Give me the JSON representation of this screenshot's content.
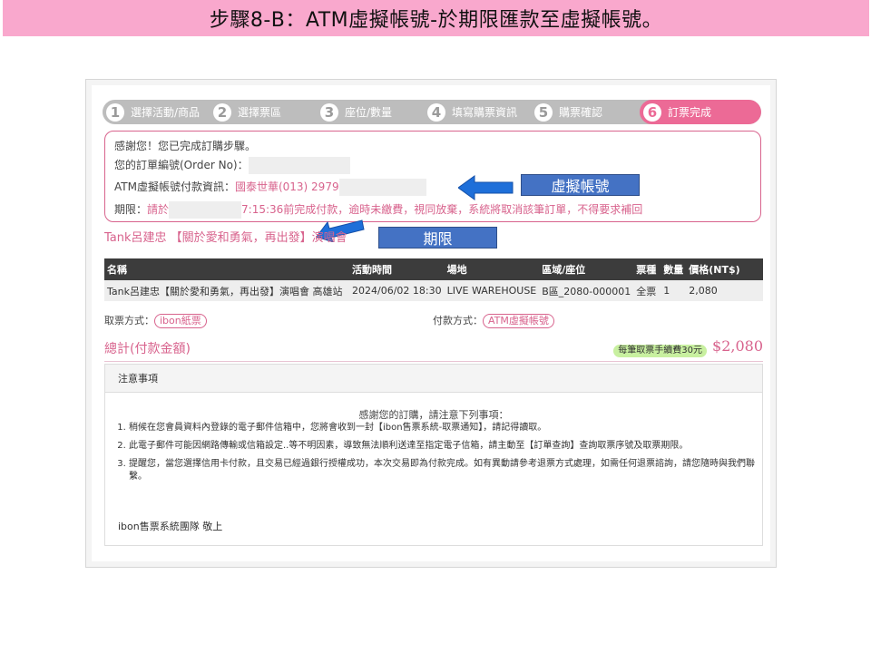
{
  "banner": {
    "title": "步驟8-B：ATM虛擬帳號-於期限匯款至虛擬帳號。"
  },
  "steps": [
    {
      "num": "1",
      "label": "選擇活動/商品"
    },
    {
      "num": "2",
      "label": "選擇票區"
    },
    {
      "num": "3",
      "label": "座位/數量"
    },
    {
      "num": "4",
      "label": "填寫購票資訊"
    },
    {
      "num": "5",
      "label": "購票確認"
    },
    {
      "num": "6",
      "label": "訂票完成"
    }
  ],
  "info": {
    "thanks": "感謝您！您已完成訂購步驟。",
    "order_no_label": "您的訂單編號(Order No)：",
    "atm_label": "ATM虛擬帳號付款資訊：",
    "atm_value": "國泰世華(013)  2979",
    "deadline_label": "期限：",
    "deadline_prefix": "請於",
    "deadline_time": "7:15:36前完成付款，逾時未繳費，視同放棄，系統將取消該筆訂單，不得要求補回"
  },
  "callouts": {
    "virtual_account": "虛擬帳號",
    "deadline": "期限"
  },
  "event_title": "Tank呂建忠 【關於愛和勇氣，再出發】演唱會",
  "table": {
    "headers": [
      "名稱",
      "活動時間",
      "場地",
      "區域/座位",
      "票種",
      "數量",
      "價格(NT$)"
    ],
    "rows": [
      [
        "Tank呂建忠【關於愛和勇氣，再出發】演唱會 高雄站",
        "2024/06/02 18:30",
        "LIVE WAREHOUSE",
        "B區_2080-000001",
        "全票",
        "1",
        "2,080"
      ]
    ]
  },
  "payment": {
    "pickup_label": "取票方式：",
    "pickup_value": "ibon紙票",
    "pay_label": "付款方式：",
    "pay_value": "ATM虛擬帳號"
  },
  "total": {
    "label": "總計(付款金額)",
    "fee_badge": "每筆取票手續費30元",
    "amount": "$2,080"
  },
  "notice": {
    "header": "注意事項",
    "thanks": "感謝您的訂購，請注意下列事項：",
    "items": [
      "稍候在您會員資料內登錄的電子郵件信箱中，您將會收到一封【ibon售票系統-取票通知】，請記得讀取。",
      "此電子郵件可能因網路傳輸或信箱設定..等不明因素，導致無法順利送達至指定電子信箱，請主動至【訂單查詢】查詢取票序號及取票期限。",
      "提醒您，當您選擇信用卡付款，且交易已經過銀行授權成功，本次交易即為付款完成。如有異動請參考退票方式處理，如需任何退票諮詢，請您隨時與我們聯繫。"
    ],
    "sign": "ibon售票系統團隊 敬上"
  },
  "colors": {
    "accent": "#d8638d",
    "banner": "#f9a8cd",
    "callout": "#4472c4",
    "arrow": "#1e6fd9"
  }
}
